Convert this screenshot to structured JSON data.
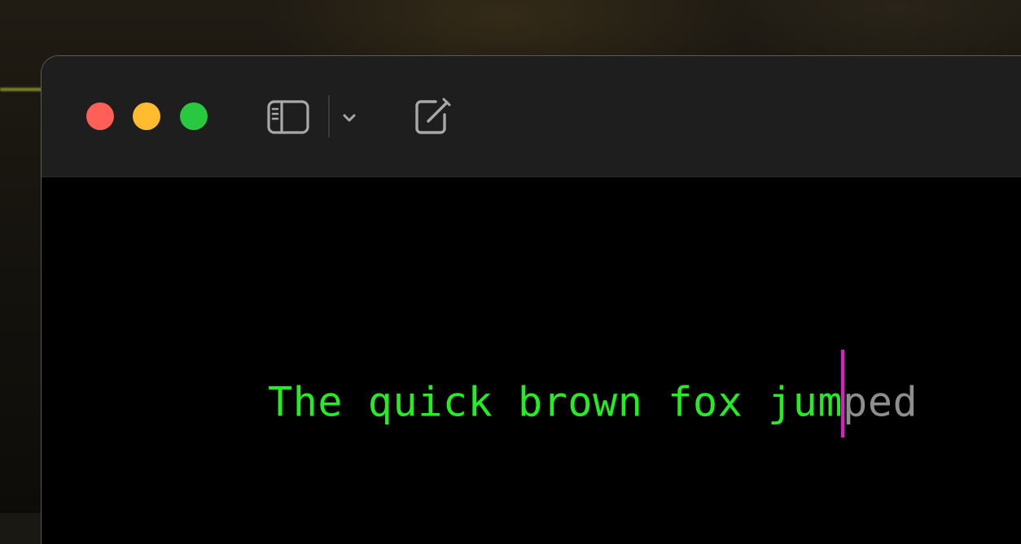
{
  "window": {
    "traffic_lights": {
      "close": {
        "color": "#fe5f57"
      },
      "minimize": {
        "color": "#febc2e"
      },
      "zoom": {
        "color": "#28c840"
      }
    },
    "toolbar": {
      "icons": [
        "sidebar-toggle-icon",
        "chevron-down-icon",
        "compose-icon"
      ]
    }
  },
  "editor": {
    "typed_text": "The quick brown fox jum",
    "suggestion_text": "ped",
    "colors": {
      "typed": "#22ee22",
      "suggestion": "#8e8e8e",
      "caret": "#e318d0",
      "background": "#000000"
    }
  }
}
